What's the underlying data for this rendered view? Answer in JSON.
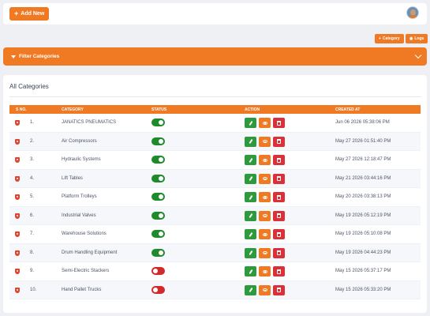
{
  "header": {
    "add_new_label": "Add New"
  },
  "toolbar": {
    "category_label": "Category",
    "logs_label": "Logs"
  },
  "filter": {
    "label": "Filter Categories"
  },
  "card": {
    "title": "All Categories"
  },
  "table": {
    "columns": [
      "S NO.",
      "CATEGORY",
      "STATUS",
      "ACTION",
      "CREATED AT"
    ],
    "rows": [
      {
        "sno": "1.",
        "category": "JANATICS PNEUMATICS",
        "status": "on",
        "created": "Jun 06 2026 05:38:06 PM"
      },
      {
        "sno": "2.",
        "category": "Air Compressors",
        "status": "on",
        "created": "May 27 2026 01:51:40 PM"
      },
      {
        "sno": "3.",
        "category": "Hydraulic Systems",
        "status": "on",
        "created": "May 27 2026 12:18:47 PM"
      },
      {
        "sno": "4.",
        "category": "Lift Tables",
        "status": "on",
        "created": "May 21 2026 03:44:16 PM"
      },
      {
        "sno": "5.",
        "category": "Platform Trolleys",
        "status": "on",
        "created": "May 20 2026 03:38:13 PM"
      },
      {
        "sno": "6.",
        "category": "Industrial Valves",
        "status": "on",
        "created": "May 19 2026 05:12:19 PM"
      },
      {
        "sno": "7.",
        "category": "Warehouse Solutions",
        "status": "on",
        "created": "May 19 2026 05:10:08 PM"
      },
      {
        "sno": "8.",
        "category": "Drum Handling Equipment",
        "status": "on",
        "created": "May 19 2026 04:44:23 PM"
      },
      {
        "sno": "9.",
        "category": "Semi-Electric Stackers",
        "status": "off",
        "created": "May 15 2026 05:37:17 PM"
      },
      {
        "sno": "10.",
        "category": "Hand Pallet Trucks",
        "status": "off",
        "created": "May 15 2026 05:33:20 PM"
      }
    ]
  },
  "colors": {
    "accent": "#f07a24",
    "toggle_on": "#1f8a2b",
    "toggle_off": "#d12a2a",
    "edit": "#2e9a3e",
    "delete": "#d9303a"
  },
  "icons": [
    "plus-icon",
    "avatar",
    "eye-icon",
    "funnel-icon",
    "chevron-down-icon",
    "shield-icon",
    "pencil-icon",
    "trash-icon"
  ]
}
